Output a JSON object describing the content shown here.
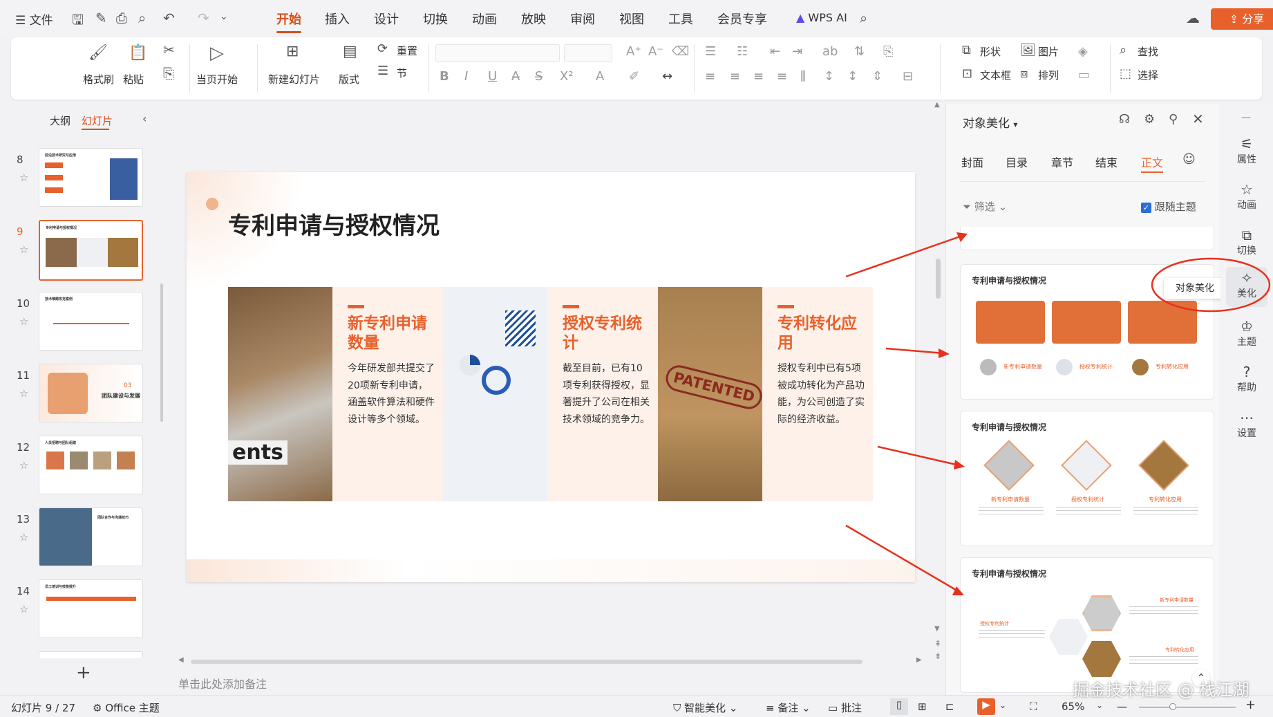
{
  "menubar": {
    "file": "文件",
    "tabs": [
      "开始",
      "插入",
      "设计",
      "切换",
      "动画",
      "放映",
      "审阅",
      "视图",
      "工具",
      "会员专享"
    ],
    "active_tab": "开始",
    "wps_ai": "WPS AI",
    "share": "分享"
  },
  "ribbon": {
    "format_painter": "格式刷",
    "paste": "粘贴",
    "play_current": "当页开始",
    "new_slide": "新建幻灯片",
    "layout": "版式",
    "reset": "重置",
    "section": "节",
    "shape": "形状",
    "picture": "图片",
    "textbox": "文本框",
    "arrange": "排列",
    "find": "查找",
    "select": "选择"
  },
  "leftpanel": {
    "tab_outline": "大纲",
    "tab_slides": "幻灯片",
    "slide_numbers": [
      "8",
      "9",
      "10",
      "11",
      "12",
      "13",
      "14"
    ],
    "thumb_titles": [
      "前沿技术研究与应用",
      "专利申请与授权情况",
      "技术难题攻克案例",
      "团队建设与发展",
      "人员招聘与团队组建",
      "团队合作与沟通技巧",
      "员工培训与技能提升"
    ],
    "thumb11_num": "03",
    "thumb11_text": "团队建设与发展",
    "add": "+"
  },
  "slide": {
    "title": "专利申请与授权情况",
    "columns": [
      {
        "heading": "新专利申请数量",
        "body": "今年研发部共提交了20项新专利申请，涵盖软件算法和硬件设计等多个领域。"
      },
      {
        "heading": "授权专利统计",
        "body": "截至目前，已有10项专利获得授权，显著提升了公司在相关技术领域的竞争力。"
      },
      {
        "heading": "专利转化应用",
        "body": "授权专利中已有5项被成功转化为产品功能，为公司创造了实际的经济收益。"
      }
    ],
    "img1_text": "ents",
    "img3_text": "PATENTED"
  },
  "notes": "单击此处添加备注",
  "rightpanel": {
    "title": "对象美化",
    "tabs": [
      "封面",
      "目录",
      "章节",
      "结束",
      "正文"
    ],
    "active_tab": "正文",
    "filter": "筛选",
    "follow_theme": "跟随主题",
    "card_title": "专利申请与授权情况",
    "card_labels": [
      "新专利申请数量",
      "授权专利统计",
      "专利转化应用"
    ],
    "tooltip": "对象美化"
  },
  "sidebar": [
    "属性",
    "动画",
    "切换",
    "美化",
    "主题",
    "帮助",
    "设置"
  ],
  "status": {
    "slide_info": "幻灯片 9 / 27",
    "theme": "Office 主题",
    "smart": "智能美化",
    "notes": "备注",
    "comments": "批注",
    "zoom": "65%"
  },
  "watermark": "掘金技术社区 @ 栈江湖",
  "colors": {
    "accent": "#e8612c",
    "heading": "#e8612c",
    "card_orange": "#e07038"
  }
}
